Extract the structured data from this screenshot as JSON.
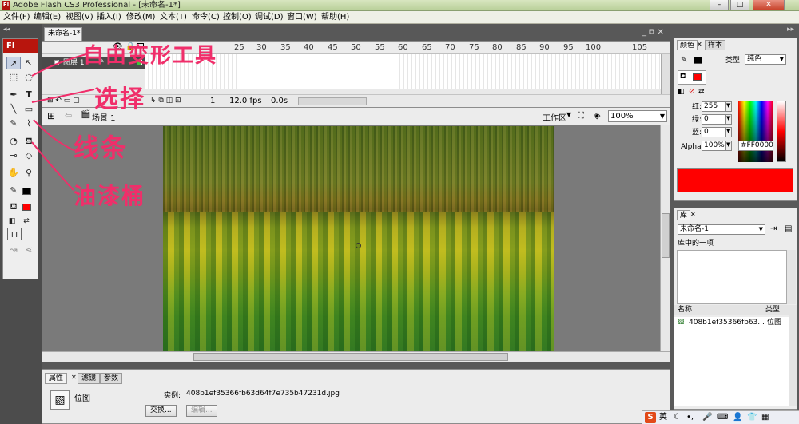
{
  "window": {
    "app_icon": "Fl",
    "title": "Adobe Flash CS3 Professional - [未命名-1*]",
    "controls": [
      "–",
      "□",
      "✕"
    ]
  },
  "menu": [
    "文件(F)",
    "编辑(E)",
    "视图(V)",
    "插入(I)",
    "修改(M)",
    "文本(T)",
    "命令(C)",
    "控制(O)",
    "调试(D)",
    "窗口(W)",
    "帮助(H)"
  ],
  "toolbox": {
    "logo": "Fl",
    "tools": [
      "selection-arrow",
      "subselection-arrow",
      "free-transform",
      "lasso",
      "pen",
      "text",
      "line",
      "rectangle",
      "pencil",
      "brush",
      "ink-bottle",
      "paint-bucket",
      "eyedropper",
      "eraser",
      "hand",
      "zoom"
    ],
    "stroke_color": "#000000",
    "fill_color": "#ff0000"
  },
  "document": {
    "tab": "未命名-1*"
  },
  "timeline": {
    "frame_numbers": [
      "25",
      "30",
      "35",
      "40",
      "45",
      "50",
      "55",
      "60",
      "65",
      "70",
      "75",
      "80",
      "85",
      "90",
      "95",
      "100",
      "105"
    ],
    "layer_name": "图层 1",
    "current_frame": "1",
    "fps": "12.0 fps",
    "time": "0.0s"
  },
  "editbar": {
    "scene": "场景 1",
    "workspace": "工作区",
    "zoom": "100%"
  },
  "annotations": {
    "free_transform": "自由变形工具",
    "selection": "选择",
    "line": "线条",
    "paint_bucket": "油漆桶"
  },
  "properties": {
    "tabs": [
      "属性",
      "滤镜",
      "参数"
    ],
    "type_label": "位图",
    "instance_label": "实例:",
    "instance_value": "408b1ef35366fb63d64f7e735b47231d.jpg",
    "swap_button": "交换...",
    "edit_button": "编辑..."
  },
  "color_panel": {
    "tabs": [
      "颜色",
      "样本"
    ],
    "type_label": "类型:",
    "type_value": "纯色",
    "red_label": "红:",
    "red_value": "255",
    "green_label": "绿:",
    "green_value": "0",
    "blue_label": "蓝:",
    "blue_value": "0",
    "alpha_label": "Alpha:",
    "alpha_value": "100%",
    "hex_value": "#FF0000",
    "current_color": "#ff0000"
  },
  "library": {
    "tab": "库",
    "document": "未命名-1",
    "item_count": "库中的一项",
    "col_name": "名称",
    "col_type": "类型",
    "item_name": "408b1ef35366fb63...",
    "item_type": "位图"
  },
  "tray": {
    "ime": "英",
    "ime_logo": "S"
  }
}
